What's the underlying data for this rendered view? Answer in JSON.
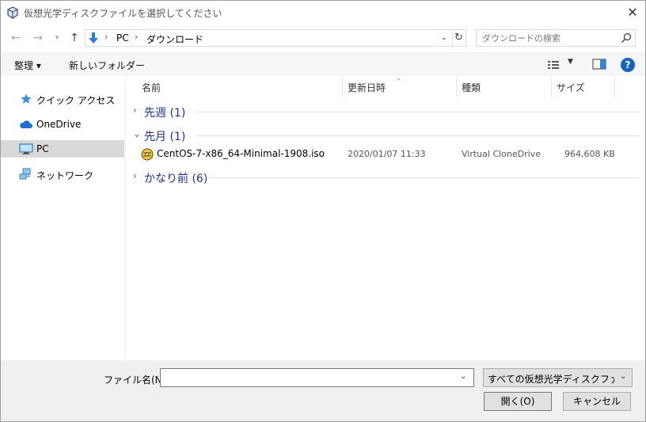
{
  "window": {
    "title": "仮想光学ディスクファイルを選択してください"
  },
  "address": {
    "crumbs": [
      "PC",
      "ダウンロード"
    ]
  },
  "search": {
    "placeholder": "ダウンロードの検索"
  },
  "toolbar": {
    "organize_label": "整理 ▾",
    "new_folder_label": "新しいフォルダー"
  },
  "navigation": {
    "items": [
      {
        "label": "クイック アクセス",
        "icon": "star-icon"
      },
      {
        "label": "OneDrive",
        "icon": "cloud-icon"
      },
      {
        "label": "PC",
        "icon": "computer-icon",
        "selected": true
      },
      {
        "label": "ネットワーク",
        "icon": "network-icon"
      }
    ]
  },
  "columns": {
    "name": "名前",
    "date": "更新日時",
    "type": "種類",
    "size": "サイズ"
  },
  "groups": [
    {
      "label": "先週 (1)",
      "expanded": false
    },
    {
      "label": "先月 (1)",
      "expanded": true
    },
    {
      "label": "かなり前 (6)",
      "expanded": false
    }
  ],
  "files": [
    {
      "name": "CentOS-7-x86_64-Minimal-1908.iso",
      "date": "2020/01/07 11:33",
      "type": "Virtual CloneDrive",
      "size": "964,608 KB",
      "icon": "disc-image-icon"
    }
  ],
  "bottom": {
    "filename_label": "ファイル名(N):",
    "filename_value": "",
    "filter_value": "すべての仮想光学ディスクファイル (*",
    "open_label": "開く(O)",
    "cancel_label": "キャンセル"
  },
  "colors": {
    "accent": "#0078d7",
    "group_text": "#1e3287",
    "selected_nav": "#d9d9d9"
  }
}
